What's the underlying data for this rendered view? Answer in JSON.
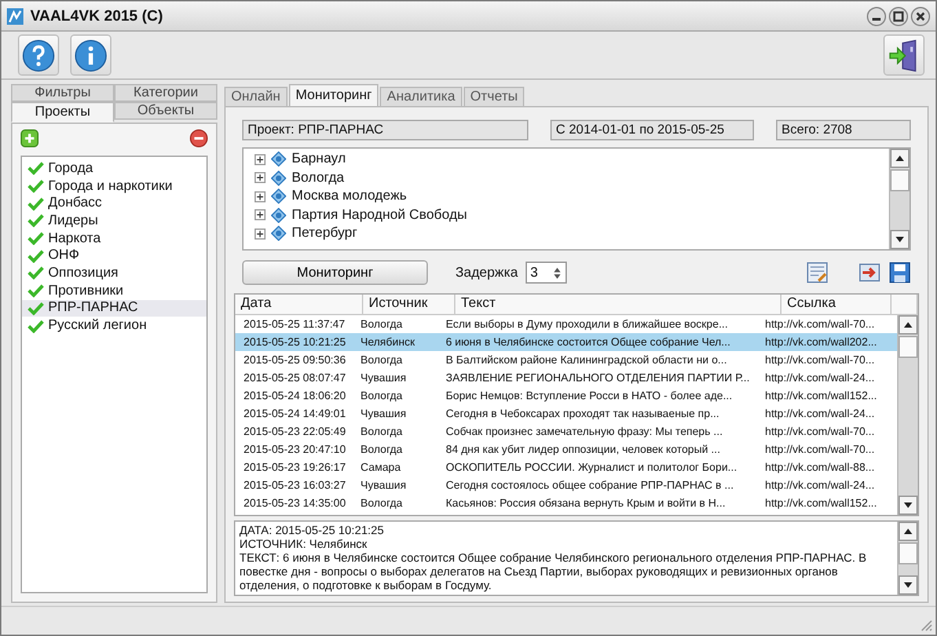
{
  "window": {
    "title": "VAAL4VK 2015 (C)"
  },
  "left_tabs": [
    {
      "label": "Фильтры",
      "selected": false
    },
    {
      "label": "Категории",
      "selected": false
    },
    {
      "label": "Проекты",
      "selected": true
    },
    {
      "label": "Объекты",
      "selected": false
    }
  ],
  "projects": [
    {
      "label": "Города",
      "selected": false
    },
    {
      "label": "Города и наркотики",
      "selected": false
    },
    {
      "label": "Донбасс",
      "selected": false
    },
    {
      "label": "Лидеры",
      "selected": false
    },
    {
      "label": "Наркота",
      "selected": false
    },
    {
      "label": "ОНФ",
      "selected": false
    },
    {
      "label": "Оппозиция",
      "selected": false
    },
    {
      "label": "Противники",
      "selected": false
    },
    {
      "label": "РПР-ПАРНАС",
      "selected": true
    },
    {
      "label": "Русский легион",
      "selected": false
    }
  ],
  "main_tabs": [
    {
      "label": "Онлайн",
      "selected": false
    },
    {
      "label": "Мониторинг",
      "selected": true
    },
    {
      "label": "Аналитика",
      "selected": false
    },
    {
      "label": "Отчеты",
      "selected": false
    }
  ],
  "info": {
    "project": "Проект: РПР-ПАРНАС",
    "period": "С 2014-01-01 по 2015-05-25",
    "total": "Всего: 2708"
  },
  "sources": [
    "Барнаул",
    "Вологда",
    "Москва молодежь",
    "Партия Народной Свободы",
    "Петербург"
  ],
  "monitor_button": "Мониторинг",
  "delay": {
    "label": "Задержка",
    "value": "3"
  },
  "table": {
    "columns": [
      "Дата",
      "Источник",
      "Текст",
      "Ссылка"
    ],
    "rows": [
      {
        "cells": [
          "2015-05-25 11:37:47",
          "Вологда",
          "Если выборы в Думу проходили в ближайшее воскре...",
          "http://vk.com/wall-70..."
        ],
        "selected": false
      },
      {
        "cells": [
          "2015-05-25 10:21:25",
          "Челябинск",
          "6 июня в Челябинске состоится Общее собрание Чел...",
          "http://vk.com/wall202..."
        ],
        "selected": true
      },
      {
        "cells": [
          "2015-05-25 09:50:36",
          "Вологда",
          "В Балтийском районе Калининградской области ни о...",
          "http://vk.com/wall-70..."
        ],
        "selected": false
      },
      {
        "cells": [
          "2015-05-25 08:07:47",
          "Чувашия",
          "ЗАЯВЛЕНИЕ РЕГИОНАЛЬНОГО ОТДЕЛЕНИЯ ПАРТИИ Р...",
          "http://vk.com/wall-24..."
        ],
        "selected": false
      },
      {
        "cells": [
          "2015-05-24 18:06:20",
          "Вологда",
          "Борис Немцов: Вступление Росси в НАТО - более аде...",
          "http://vk.com/wall152..."
        ],
        "selected": false
      },
      {
        "cells": [
          "2015-05-24 14:49:01",
          "Чувашия",
          "Сегодня в Чебоксарах проходят так называеные пр...",
          "http://vk.com/wall-24..."
        ],
        "selected": false
      },
      {
        "cells": [
          "2015-05-23 22:05:49",
          "Вологда",
          "Собчак произнес замечательную фразу: Мы теперь ...",
          "http://vk.com/wall-70..."
        ],
        "selected": false
      },
      {
        "cells": [
          "2015-05-23 20:47:10",
          "Вологда",
          "84 дня как убит лидер оппозиции, человек который ...",
          "http://vk.com/wall-70..."
        ],
        "selected": false
      },
      {
        "cells": [
          "2015-05-23 19:26:17",
          "Самара",
          "ОСКОПИТЕЛЬ РОССИИ. Журналист и политолог Бори...",
          "http://vk.com/wall-88..."
        ],
        "selected": false
      },
      {
        "cells": [
          "2015-05-23 16:03:27",
          "Чувашия",
          "Сегодня состоялось общее собрание РПР-ПАРНАС в ...",
          "http://vk.com/wall-24..."
        ],
        "selected": false
      },
      {
        "cells": [
          "2015-05-23 14:35:00",
          "Вологда",
          "Касьянов: Россия обязана вернуть Крым и войти в Н...",
          "http://vk.com/wall152..."
        ],
        "selected": false
      }
    ]
  },
  "detail": [
    "ДАТА: 2015-05-25 10:21:25",
    "ИСТОЧНИК: Челябинск",
    "ТЕКСТ: 6 июня в Челябинске состоится Общее собрание Челябинского регионального отделения РПР-ПАРНАС. В повестке дня - вопросы о выборах делегатов на Сьезд Партии, выборах руководящих и ревизионных органов отделения, о подготовке к выборам в Госдуму."
  ]
}
